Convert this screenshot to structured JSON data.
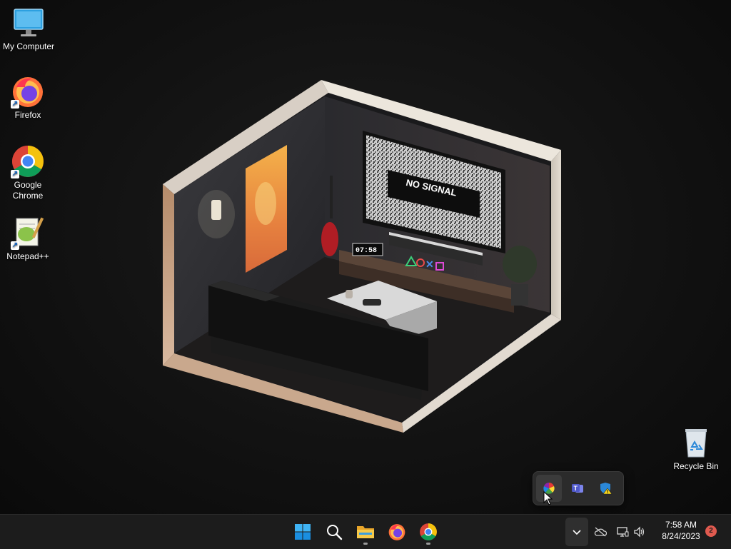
{
  "desktop": {
    "icons": [
      {
        "label": "My Computer",
        "icon": "monitor-icon"
      },
      {
        "label": "Firefox",
        "icon": "firefox-icon"
      },
      {
        "label": "Google Chrome",
        "icon": "chrome-icon"
      },
      {
        "label": "Notepad++",
        "icon": "notepadpp-icon"
      },
      {
        "label": "Recycle Bin",
        "icon": "recycle-bin-icon"
      }
    ],
    "wallpaper": {
      "tv_text": "NO SIGNAL",
      "clock_text": "07:58"
    }
  },
  "tray_popup": {
    "items": [
      {
        "icon": "color-wheel-icon",
        "active": true
      },
      {
        "icon": "teams-icon",
        "active": false
      },
      {
        "icon": "security-warning-icon",
        "active": false
      }
    ]
  },
  "taskbar": {
    "apps": [
      {
        "icon": "windows-start-icon"
      },
      {
        "icon": "search-icon"
      },
      {
        "icon": "file-explorer-icon"
      },
      {
        "icon": "firefox-icon"
      },
      {
        "icon": "chrome-icon"
      }
    ],
    "system": {
      "time": "7:58 AM",
      "date": "8/24/2023",
      "notification_count": "2"
    }
  },
  "colors": {
    "taskbar_bg": "#1c1c1c",
    "badge": "#e05a4f",
    "accent": "#0078d4"
  }
}
